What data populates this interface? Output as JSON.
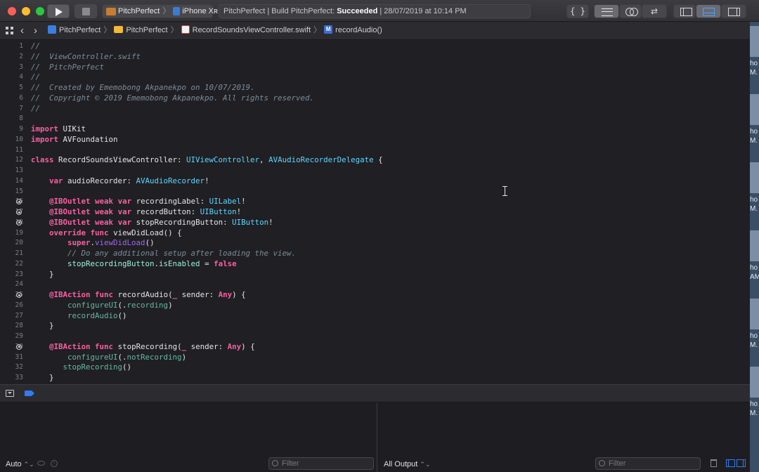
{
  "toolbar": {
    "scheme_project": "PitchPerfect",
    "scheme_device": "iPhone Xʀ",
    "status_prefix": "PitchPerfect | Build PitchPerfect: ",
    "status_result": "Succeeded",
    "status_suffix": " | 28/07/2019 at 10:14 PM",
    "library_label": "{ }"
  },
  "jumpbar": {
    "crumbs": [
      "PitchPerfect",
      "PitchPerfect",
      "RecordSoundsViewController.swift",
      "recordAudio()"
    ],
    "method_badge": "M",
    "back": "‹",
    "forward": "›",
    "separator": "〉"
  },
  "editor": {
    "line_numbers": [
      "1",
      "2",
      "3",
      "4",
      "5",
      "6",
      "7",
      "8",
      "9",
      "10",
      "11",
      "12",
      "13",
      "14",
      "15",
      "16",
      "17",
      "18",
      "19",
      "20",
      "21",
      "22",
      "23",
      "24",
      "25",
      "26",
      "27",
      "28",
      "29",
      "30",
      "31",
      "32",
      "33"
    ],
    "breakpoint_lines": [
      16,
      17,
      18,
      25,
      30
    ],
    "lines": [
      [
        [
          "comment",
          "//"
        ]
      ],
      [
        [
          "comment",
          "//  ViewController.swift"
        ]
      ],
      [
        [
          "comment",
          "//  PitchPerfect"
        ]
      ],
      [
        [
          "comment",
          "//"
        ]
      ],
      [
        [
          "comment",
          "//  Created by Ememobong Akpanekpo on 10/07/2019."
        ]
      ],
      [
        [
          "comment",
          "//  Copyright © 2019 Ememobong Akpanekpo. All rights reserved."
        ]
      ],
      [
        [
          "comment",
          "//"
        ]
      ],
      [],
      [
        [
          "kw",
          "import"
        ],
        [
          "plain",
          " UIKit"
        ]
      ],
      [
        [
          "kw",
          "import"
        ],
        [
          "plain",
          " AVFoundation"
        ]
      ],
      [],
      [
        [
          "kw",
          "class"
        ],
        [
          "plain",
          " RecordSoundsViewController: "
        ],
        [
          "type",
          "UIViewController"
        ],
        [
          "plain",
          ", "
        ],
        [
          "type",
          "AVAudioRecorderDelegate"
        ],
        [
          "plain",
          " {"
        ]
      ],
      [],
      [
        [
          "plain",
          "    "
        ],
        [
          "kw",
          "var"
        ],
        [
          "plain",
          " audioRecorder: "
        ],
        [
          "type",
          "AVAudioRecorder"
        ],
        [
          "plain",
          "!"
        ]
      ],
      [],
      [
        [
          "plain",
          "    "
        ],
        [
          "kw",
          "@IBOutlet"
        ],
        [
          "plain",
          " "
        ],
        [
          "kw",
          "weak"
        ],
        [
          "plain",
          " "
        ],
        [
          "kw",
          "var"
        ],
        [
          "plain",
          " recordingLabel: "
        ],
        [
          "type",
          "UILabel"
        ],
        [
          "plain",
          "!"
        ]
      ],
      [
        [
          "plain",
          "    "
        ],
        [
          "kw",
          "@IBOutlet"
        ],
        [
          "plain",
          " "
        ],
        [
          "kw",
          "weak"
        ],
        [
          "plain",
          " "
        ],
        [
          "kw",
          "var"
        ],
        [
          "plain",
          " recordButton: "
        ],
        [
          "type",
          "UIButton"
        ],
        [
          "plain",
          "!"
        ]
      ],
      [
        [
          "plain",
          "    "
        ],
        [
          "kw",
          "@IBOutlet"
        ],
        [
          "plain",
          " "
        ],
        [
          "kw",
          "weak"
        ],
        [
          "plain",
          " "
        ],
        [
          "kw",
          "var"
        ],
        [
          "plain",
          " stopRecordingButton: "
        ],
        [
          "type",
          "UIButton"
        ],
        [
          "plain",
          "!"
        ]
      ],
      [
        [
          "plain",
          "    "
        ],
        [
          "kw",
          "override"
        ],
        [
          "plain",
          " "
        ],
        [
          "kw",
          "func"
        ],
        [
          "plain",
          " viewDidLoad() {"
        ]
      ],
      [
        [
          "plain",
          "        "
        ],
        [
          "kw",
          "super"
        ],
        [
          "plain",
          "."
        ],
        [
          "sysfn",
          "viewDidLoad"
        ],
        [
          "plain",
          "()"
        ]
      ],
      [
        [
          "plain",
          "        "
        ],
        [
          "comment",
          "// Do any additional setup after loading the view."
        ]
      ],
      [
        [
          "plain",
          "        "
        ],
        [
          "projtype",
          "stopRecordingButton"
        ],
        [
          "plain",
          "."
        ],
        [
          "projtype",
          "isEnabled"
        ],
        [
          "plain",
          " = "
        ],
        [
          "kw",
          "false"
        ]
      ],
      [
        [
          "plain",
          "    }"
        ]
      ],
      [],
      [
        [
          "plain",
          "    "
        ],
        [
          "kw",
          "@IBAction"
        ],
        [
          "plain",
          " "
        ],
        [
          "kw",
          "func"
        ],
        [
          "plain",
          " recordAudio("
        ],
        [
          "kw",
          "_"
        ],
        [
          "plain",
          " sender: "
        ],
        [
          "kw",
          "Any"
        ],
        [
          "plain",
          ") {"
        ]
      ],
      [
        [
          "plain",
          "        "
        ],
        [
          "projfn",
          "configureUI"
        ],
        [
          "plain",
          "(."
        ],
        [
          "projfn",
          "recording"
        ],
        [
          "plain",
          ")"
        ]
      ],
      [
        [
          "plain",
          "        "
        ],
        [
          "projfn",
          "recordAudio"
        ],
        [
          "plain",
          "()"
        ]
      ],
      [
        [
          "plain",
          "    }"
        ]
      ],
      [],
      [
        [
          "plain",
          "    "
        ],
        [
          "kw",
          "@IBAction"
        ],
        [
          "plain",
          " "
        ],
        [
          "kw",
          "func"
        ],
        [
          "plain",
          " stopRecording("
        ],
        [
          "kw",
          "_"
        ],
        [
          "plain",
          " sender: "
        ],
        [
          "kw",
          "Any"
        ],
        [
          "plain",
          ") {"
        ]
      ],
      [
        [
          "plain",
          "        "
        ],
        [
          "projfn",
          "configureUI"
        ],
        [
          "plain",
          "(."
        ],
        [
          "projfn",
          "notRecording"
        ],
        [
          "plain",
          ")"
        ]
      ],
      [
        [
          "plain",
          "       "
        ],
        [
          "projfn",
          "stopRecording"
        ],
        [
          "plain",
          "()"
        ]
      ],
      [
        [
          "plain",
          "    }"
        ]
      ]
    ]
  },
  "debug": {
    "variables_scope": "Auto",
    "variables_filter_placeholder": "Filter",
    "console_scope": "All Output",
    "console_filter_placeholder": "Filter",
    "popup_chevron": "⌃⌄"
  },
  "desktop_labels": [
    "ho",
    "M.",
    "ho",
    "M.",
    "ho",
    "M.",
    "ho",
    "AM",
    "ho",
    "M.",
    "ho",
    "M."
  ],
  "colors": {
    "keyword": "#fc5fa3",
    "type": "#5dd8ff",
    "project_type": "#9ef1dd",
    "project_function": "#67b7a4",
    "system_function": "#a167e6",
    "comment": "#7f8c98",
    "accent_blue": "#2f7cf6"
  }
}
